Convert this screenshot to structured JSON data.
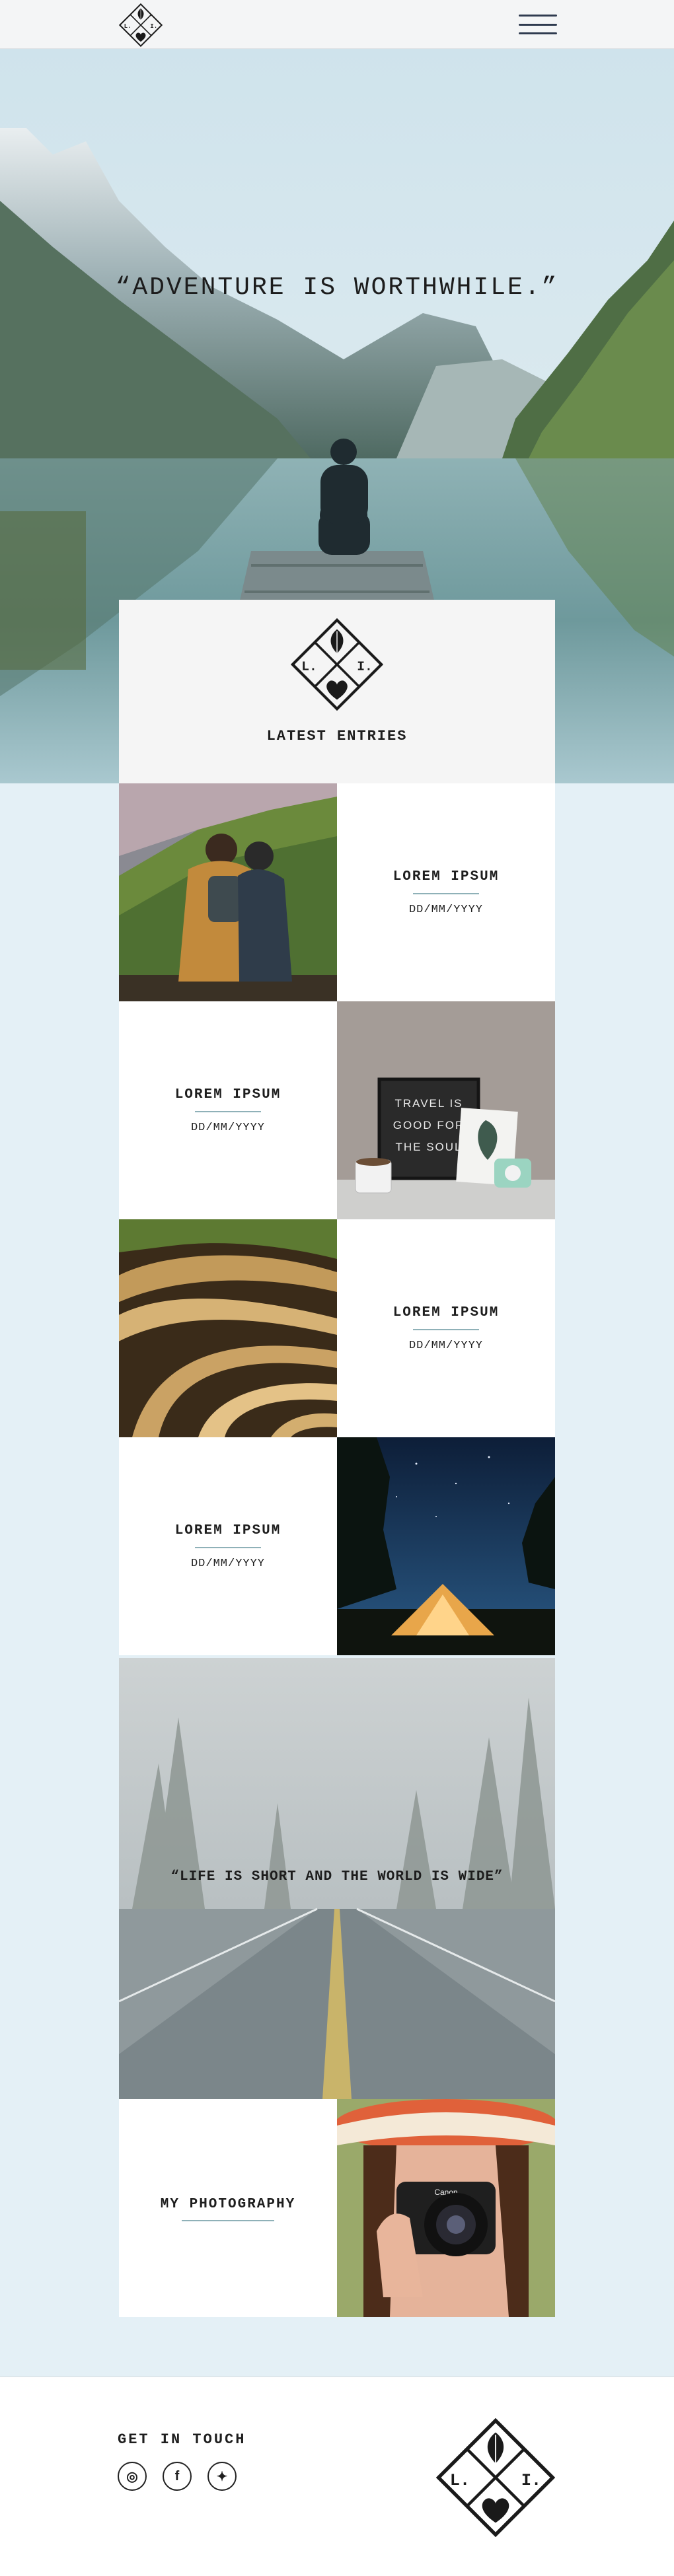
{
  "brand": {
    "logo_letters": [
      "L.",
      "I."
    ]
  },
  "nav": {
    "menu_icon": "hamburger-menu-icon"
  },
  "hero": {
    "quote": "“ADVENTURE IS WORTHWHILE.”"
  },
  "latest": {
    "title": "LATEST ENTRIES"
  },
  "entries": [
    {
      "title": "LOREM IPSUM",
      "date": "DD/MM/YYYY",
      "image": "couple-on-mountain"
    },
    {
      "title": "LOREM IPSUM",
      "date": "DD/MM/YYYY",
      "image": "letterboard-travel-is-good-for-the-soul"
    },
    {
      "title": "LOREM IPSUM",
      "date": "DD/MM/YYYY",
      "image": "rice-terraces"
    },
    {
      "title": "LOREM IPSUM",
      "date": "DD/MM/YYYY",
      "image": "tent-at-night"
    }
  ],
  "letterboard": {
    "lines": [
      "TRAVEL IS",
      "GOOD FOR",
      "THE SOUL"
    ]
  },
  "road": {
    "quote": "“LIFE IS SHORT AND THE WORLD IS WIDE”"
  },
  "photography": {
    "title": "MY PHOTOGRAPHY",
    "image": "woman-with-camera",
    "camera_brand": "Canon"
  },
  "footer": {
    "get_in_touch": "GET IN TOUCH",
    "social": [
      {
        "name": "instagram",
        "glyph": "◎"
      },
      {
        "name": "facebook",
        "glyph": "f"
      },
      {
        "name": "twitter",
        "glyph": "✦"
      }
    ]
  },
  "colors": {
    "page_bg": "#e4f0f6",
    "accent_rule": "#8fb1b8",
    "nav_bg": "#f4f5f6",
    "text": "#1e1e1e"
  }
}
